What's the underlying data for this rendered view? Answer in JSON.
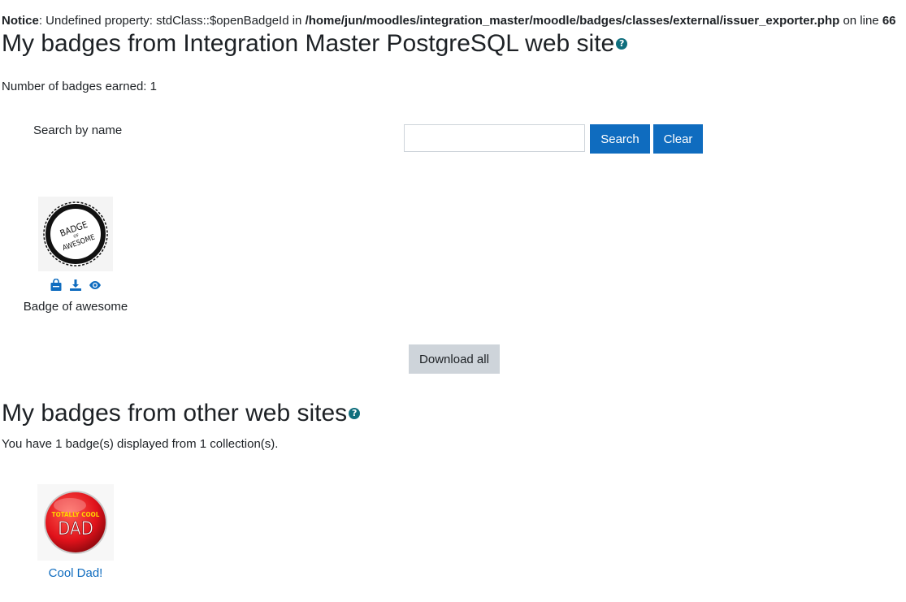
{
  "notice": {
    "label": "Notice",
    "message_prefix": ": Undefined property: stdClass::$openBadgeId in ",
    "file_path": "/home/jun/moodles/integration_master/moodle/badges/classes/external/issuer_exporter.php",
    "line_text": " on line ",
    "line_number": "66"
  },
  "local_section": {
    "title": "My badges from Integration Master PostgreSQL web site",
    "help_icon": "question-circle-icon",
    "earned_text": "Number of badges earned: 1",
    "search": {
      "label": "Search by name",
      "value": "",
      "placeholder": "",
      "search_button": "Search",
      "clear_button": "Clear"
    },
    "badges": [
      {
        "name": "Badge of awesome",
        "image_text_top": "BADGE",
        "image_text_mid": "OF",
        "image_text_bottom": "AWESOME",
        "actions": [
          "backpack-icon",
          "download-icon",
          "eye-icon"
        ]
      }
    ],
    "download_all": "Download all"
  },
  "external_section": {
    "title": "My badges from other web sites",
    "help_icon": "question-circle-icon",
    "summary": "You have 1 badge(s) displayed from 1 collection(s).",
    "badges": [
      {
        "name": "Cool Dad!",
        "image_text_top": "TOTALLY COOL",
        "image_text_main": "DAD"
      }
    ]
  },
  "colors": {
    "primary": "#0f6cbf",
    "help": "#0f6e7d",
    "secondary_button": "#ced4da",
    "text": "#1d2125"
  }
}
